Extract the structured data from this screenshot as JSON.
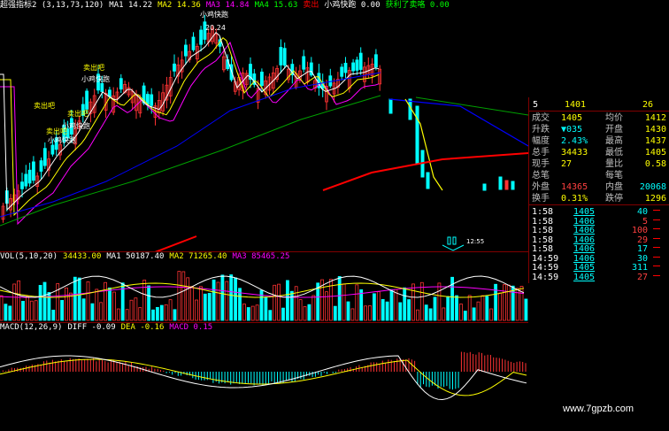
{
  "main_header": {
    "indicator": "超强指标2 (3,13,73,120)",
    "ma1": "MA1 14.22",
    "ma2": "MA2 14.36",
    "ma3": "MA3 14.84",
    "ma4": "MA4 15.63",
    "sell_fast": "卖出",
    "buy_fast": "小鸡快跑 0.00",
    "prompt": "获利了卖咯 0.00"
  },
  "annotations": {
    "peak_price": "20.24",
    "peak_label": "小鸡快跑",
    "sell1": "卖出吧",
    "chick1": "小鸡快跑",
    "sell2": "卖出吧",
    "sell3": "卖出吧",
    "chick2": "小鸡快跑",
    "sell4": "卖出吧",
    "chick3": "小鸡快跑",
    "time_marker": "12:55"
  },
  "vol_header": {
    "name": "VOL(5,10,20)",
    "v": "34433.00",
    "ma1": "MA1 50187.40",
    "ma2": "MA2 71265.40",
    "ma3": "MA3 85465.25"
  },
  "macd_header": {
    "name": "MACD(12,26,9)",
    "diff": "DIFF -0.09",
    "dea": "DEA -0.16",
    "macd": "MACD 0.15"
  },
  "quote": {
    "top_row": {
      "label": "5",
      "price": "1401",
      "vol": "26"
    },
    "rows": [
      {
        "l1": "成交",
        "v1": "1405",
        "l2": "均价",
        "v2": "1412",
        "c1": "#ffff00",
        "c2": "#ffff00"
      },
      {
        "l1": "升跌",
        "v1": "▼035",
        "l2": "开盘",
        "v2": "1430",
        "c1": "#00ffff",
        "c2": "#ffff00"
      },
      {
        "l1": "幅度",
        "v1": "2.43%",
        "l2": "最高",
        "v2": "1437",
        "c1": "#00ffff",
        "c2": "#ffff00"
      },
      {
        "l1": "总手",
        "v1": "34433",
        "l2": "最低",
        "v2": "1405",
        "c1": "#ffff00",
        "c2": "#ffff00"
      },
      {
        "l1": "现手",
        "v1": "27",
        "l2": "量比",
        "v2": "0.58",
        "c1": "#ffff00",
        "c2": "#ffff00"
      },
      {
        "l1": "总笔",
        "v1": "",
        "l2": "每笔",
        "v2": "",
        "c1": "#ffff00",
        "c2": "#ffff00"
      },
      {
        "l1": "外盘",
        "v1": "14365",
        "l2": "内盘",
        "v2": "20068",
        "c1": "#ff4040",
        "c2": "#00ffff"
      },
      {
        "l1": "换手",
        "v1": "0.31%",
        "l2": "跌停",
        "v2": "1296",
        "c1": "#ffff00",
        "c2": "#ffff00"
      }
    ],
    "ticks": [
      {
        "time": "1:58",
        "price": "1405",
        "vol": "40",
        "vc": "#00ffff"
      },
      {
        "time": "1:58",
        "price": "1406",
        "vol": "5",
        "vc": "#ff4040"
      },
      {
        "time": "1:58",
        "price": "1406",
        "vol": "100",
        "vc": "#ff4040"
      },
      {
        "time": "1:58",
        "price": "1406",
        "vol": "29",
        "vc": "#ff4040"
      },
      {
        "time": "1:58",
        "price": "1406",
        "vol": "17",
        "vc": "#00ffff"
      },
      {
        "time": "14:59",
        "price": "1406",
        "vol": "30",
        "vc": "#00ffff"
      },
      {
        "time": "14:59",
        "price": "1405",
        "vol": "311",
        "vc": "#00ffff"
      },
      {
        "time": "14:59",
        "price": "1405",
        "vol": "27",
        "vc": "#ff4040"
      }
    ]
  },
  "watermark": "www.7gpzb.com",
  "colors": {
    "up": "#ff3333",
    "down": "#00ffff",
    "ma_white": "#ffffff",
    "ma_yellow": "#ffff00",
    "ma_purple": "#ff00ff",
    "ma_green": "#00a000",
    "ma_blue": "#0000ff",
    "ma_red": "#ff0000"
  }
}
